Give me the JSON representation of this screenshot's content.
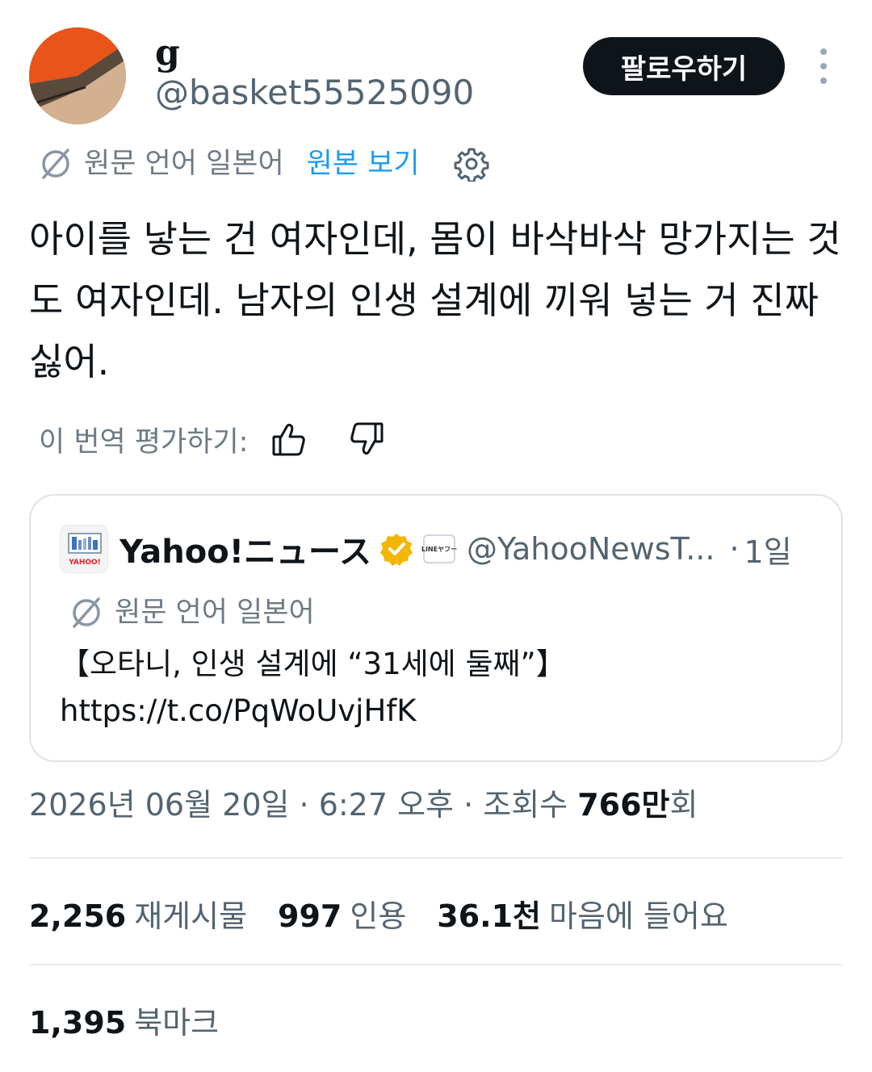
{
  "user": {
    "name": "g",
    "handle": "@basket55525090",
    "follow_label": "팔로우하기"
  },
  "translation": {
    "original_language": "원문 언어 일본어",
    "show_original": "원본 보기"
  },
  "tweet": {
    "text": "아이를 낳는 건 여자인데, 몸이 바삭바삭 망가지는 것도 여자인데. 남자의 인생 설계에 끼워 넣는 거 진짜 싫어."
  },
  "rating": {
    "label": "이 번역 평가하기:"
  },
  "quoted": {
    "name": "Yahoo!ニュース",
    "badge_text": "LINEヤフー",
    "handle": "@YahooNewsT...",
    "separator": "·",
    "time": "1일",
    "original_language": "원문 언어 일본어",
    "text_line1": "【오타니, 인생 설계에 “31세에 둘째”】",
    "text_line2": "https://t.co/PqWoUvjHfK",
    "logo_text": "YAHOO!"
  },
  "meta": {
    "date_time": "2026년 06월 20일 · 6:27 오후 · 조회수 ",
    "views_number": "766만",
    "views_suffix": "회"
  },
  "stats": {
    "reposts": "2,256",
    "reposts_label": "재게시물",
    "quotes": "997",
    "quotes_label": "인용",
    "likes": "36.1천",
    "likes_label": "마음에 들어요",
    "bookmarks": "1,395",
    "bookmarks_label": "북마크"
  },
  "colors": {
    "link": "#1d9bf0",
    "secondary_text": "#536471",
    "verified": "#f2b705",
    "follow_button": "#0f1419"
  }
}
